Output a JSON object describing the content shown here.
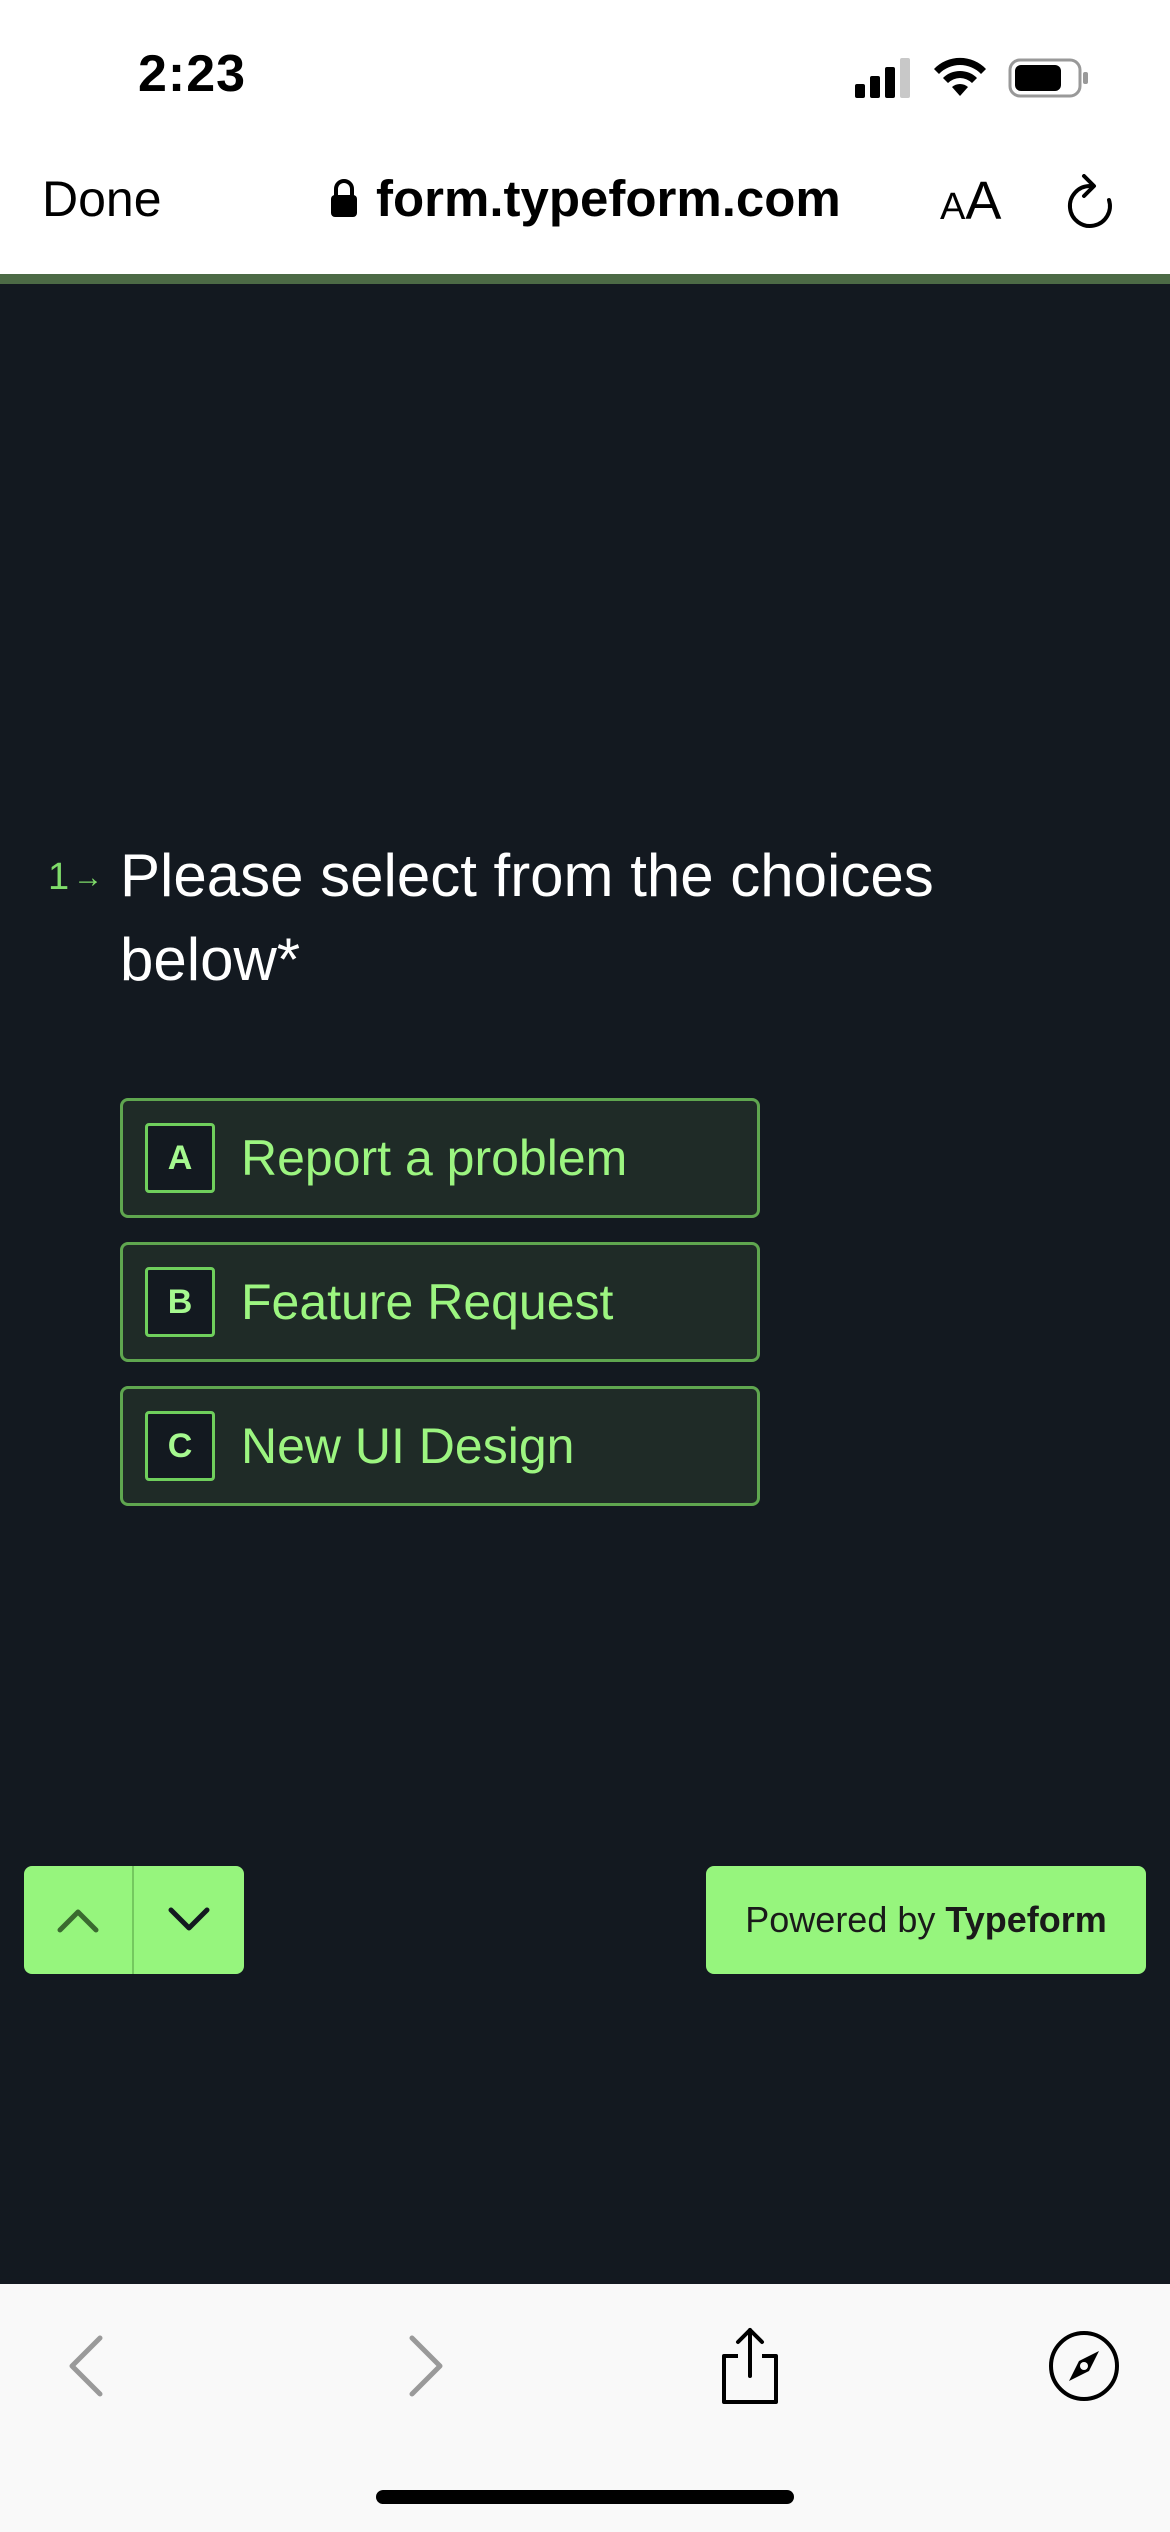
{
  "status_bar": {
    "time": "2:23"
  },
  "browser": {
    "done_label": "Done",
    "url": "form.typeform.com",
    "text_size_label_small": "A",
    "text_size_label_large": "A"
  },
  "question": {
    "number": "1",
    "text": "Please select from the choices below*"
  },
  "choices": [
    {
      "key": "A",
      "label": "Report a problem"
    },
    {
      "key": "B",
      "label": "Feature Request"
    },
    {
      "key": "C",
      "label": "New UI Design"
    }
  ],
  "footer": {
    "powered_by_prefix": "Powered by",
    "powered_by_brand": "Typeform"
  },
  "colors": {
    "background": "#131920",
    "accent": "#96f57d",
    "choice_text": "#9cf580",
    "progress": "#4c6a45"
  }
}
